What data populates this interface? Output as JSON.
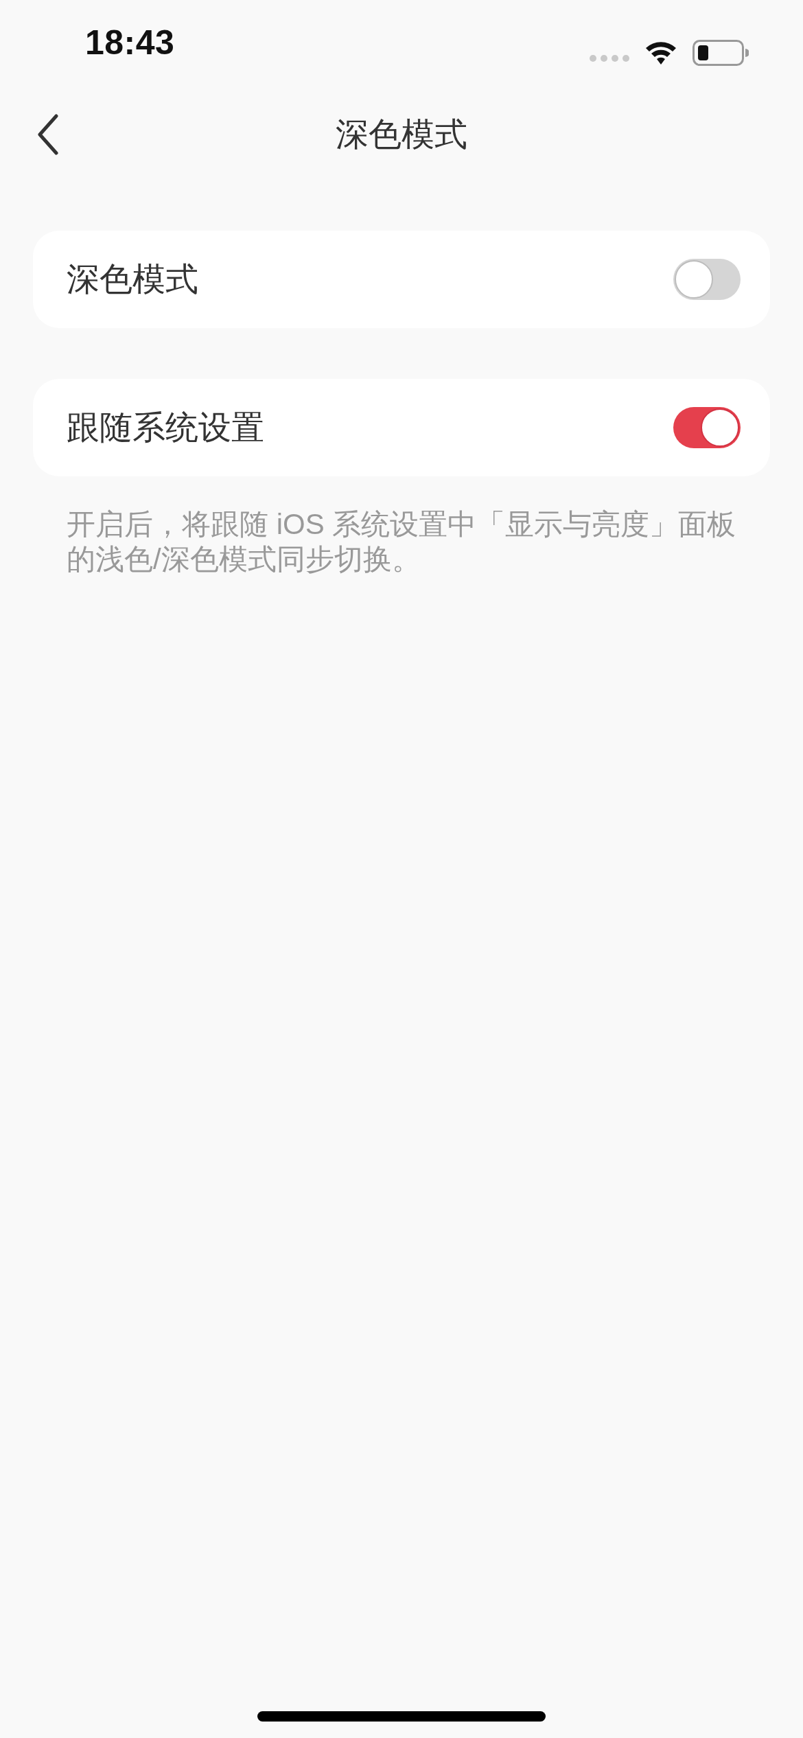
{
  "status_bar": {
    "time": "18:43"
  },
  "nav": {
    "title": "深色模式"
  },
  "settings": [
    {
      "label": "深色模式",
      "on": false
    },
    {
      "label": "跟随系统设置",
      "on": true
    }
  ],
  "note": "开启后，将跟随 iOS 系统设置中「显示与亮度」面板的浅色/深色模式同步切换。"
}
